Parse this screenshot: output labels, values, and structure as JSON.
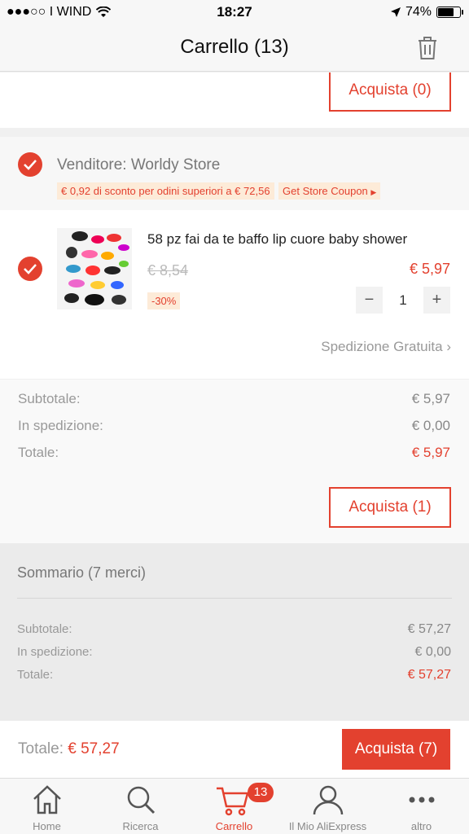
{
  "status_bar": {
    "carrier": "●●●○○ I WIND",
    "time": "18:27",
    "battery": "74%",
    "battery_level": 0.74
  },
  "header": {
    "title": "Carrello (13)",
    "trash_icon": "trash-icon"
  },
  "prev_section": {
    "buy_label": "Acquista (0)"
  },
  "seller": {
    "name": "Venditore: Worldy Store",
    "discount_tag": "€ 0,92 di sconto per odini superiori a € 72,56",
    "coupon_tag": "Get Store Coupon"
  },
  "item": {
    "title": "58 pz fai da te baffo lip cuore baby shower",
    "old_price": "€ 8,54",
    "price": "€ 5,97",
    "discount": "-30%",
    "quantity": "1",
    "minus": "−",
    "plus": "+",
    "shipping": "Spedizione Gratuita"
  },
  "seller_totals": {
    "subtotal_label": "Subtotale:",
    "subtotal_value": "€ 5,97",
    "shipping_label": "In spedizione:",
    "shipping_value": "€ 0,00",
    "total_label": "Totale:",
    "total_value": "€ 5,97",
    "buy_label": "Acquista (1)"
  },
  "summary": {
    "title": "Sommario (7 merci)",
    "subtotal_label": "Subtotale:",
    "subtotal_value": "€ 57,27",
    "shipping_label": "In spedizione:",
    "shipping_value": "€ 0,00",
    "total_label": "Totale:",
    "total_value": "€ 57,27"
  },
  "footer": {
    "total_label": "Totale:",
    "total_value": "€ 57,27",
    "buy_label": "Acquista (7)"
  },
  "tabs": [
    {
      "label": "Home",
      "icon": "home-icon"
    },
    {
      "label": "Ricerca",
      "icon": "search-icon"
    },
    {
      "label": "Carrello",
      "icon": "cart-icon",
      "badge": "13",
      "active": true
    },
    {
      "label": "Il Mio AliExpress",
      "icon": "user-icon"
    },
    {
      "label": "altro",
      "icon": "more-icon"
    }
  ],
  "colors": {
    "accent": "#e3412f",
    "tag_bg": "#fdebd8"
  }
}
